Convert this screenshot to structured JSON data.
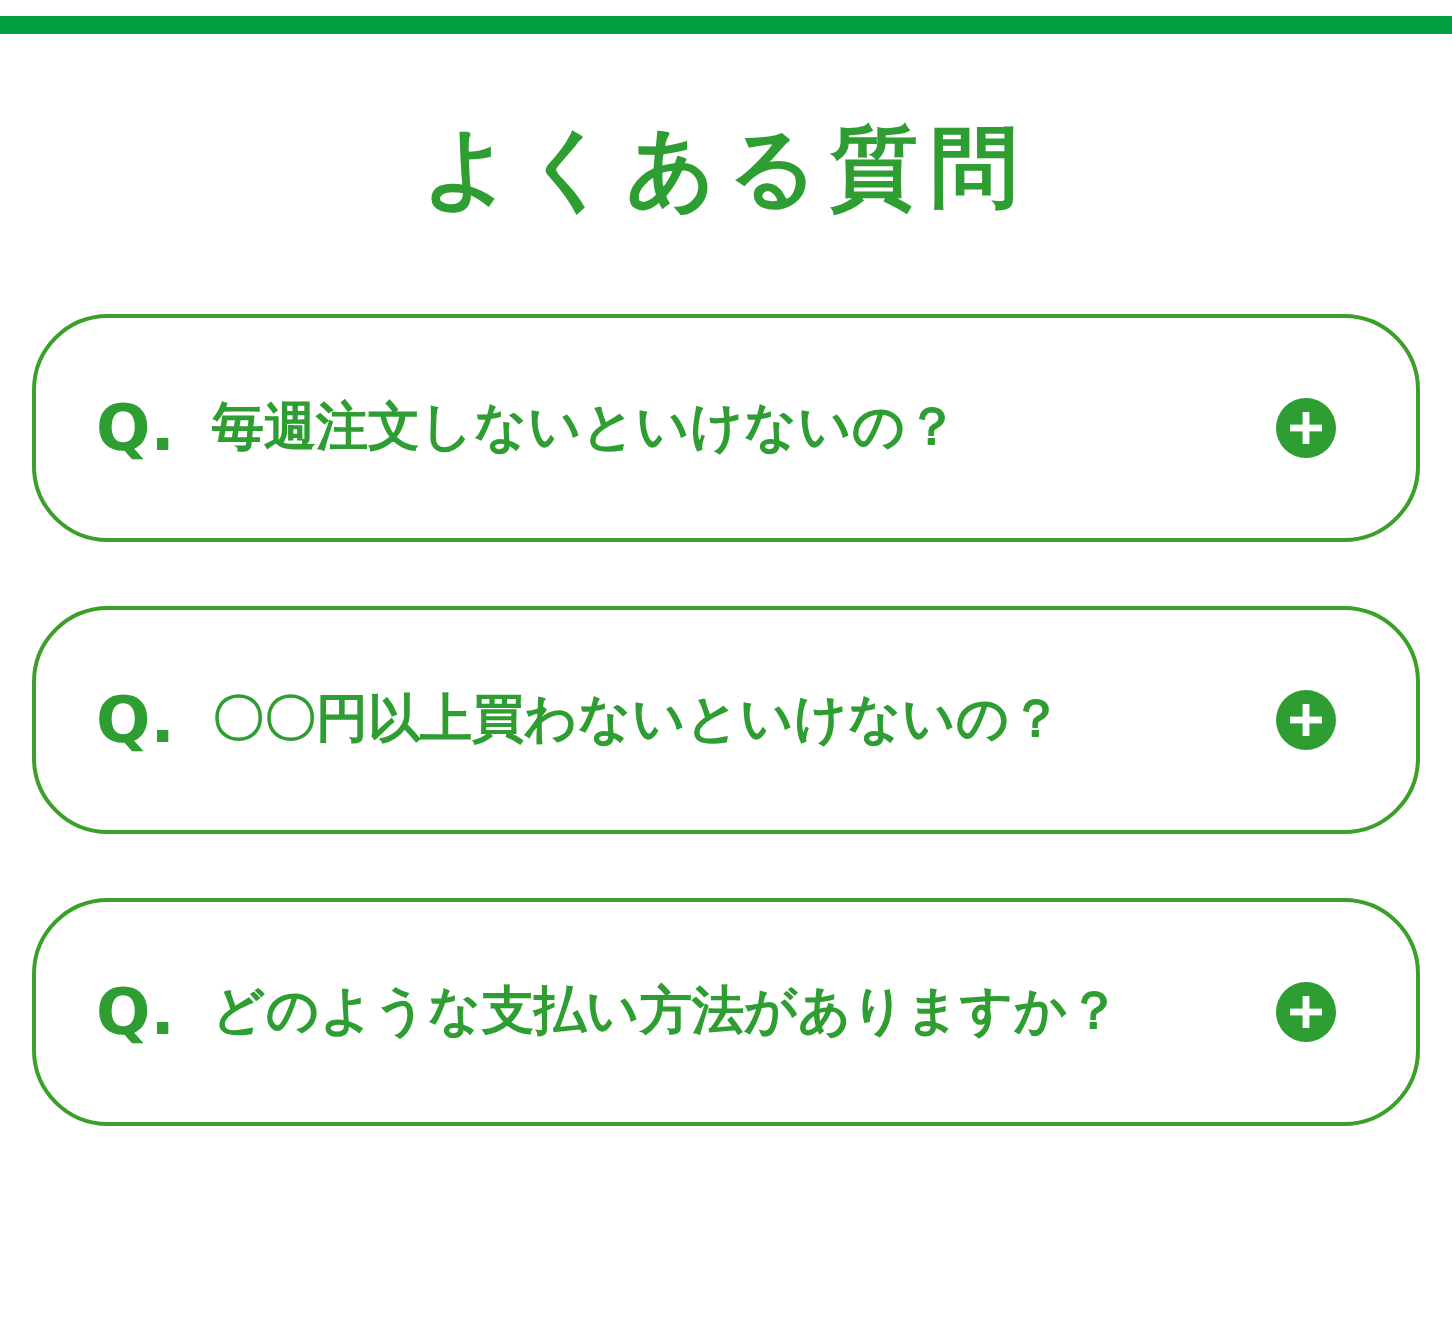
{
  "heading": "よくある質問",
  "faq": [
    {
      "marker": "Q.",
      "question": "毎週注文しないといけないの？",
      "expanded": false
    },
    {
      "marker": "Q.",
      "question": "〇〇円以上買わないといけないの？",
      "expanded": false
    },
    {
      "marker": "Q.",
      "question": "どのような支払い方法がありますか？",
      "expanded": false
    }
  ]
}
